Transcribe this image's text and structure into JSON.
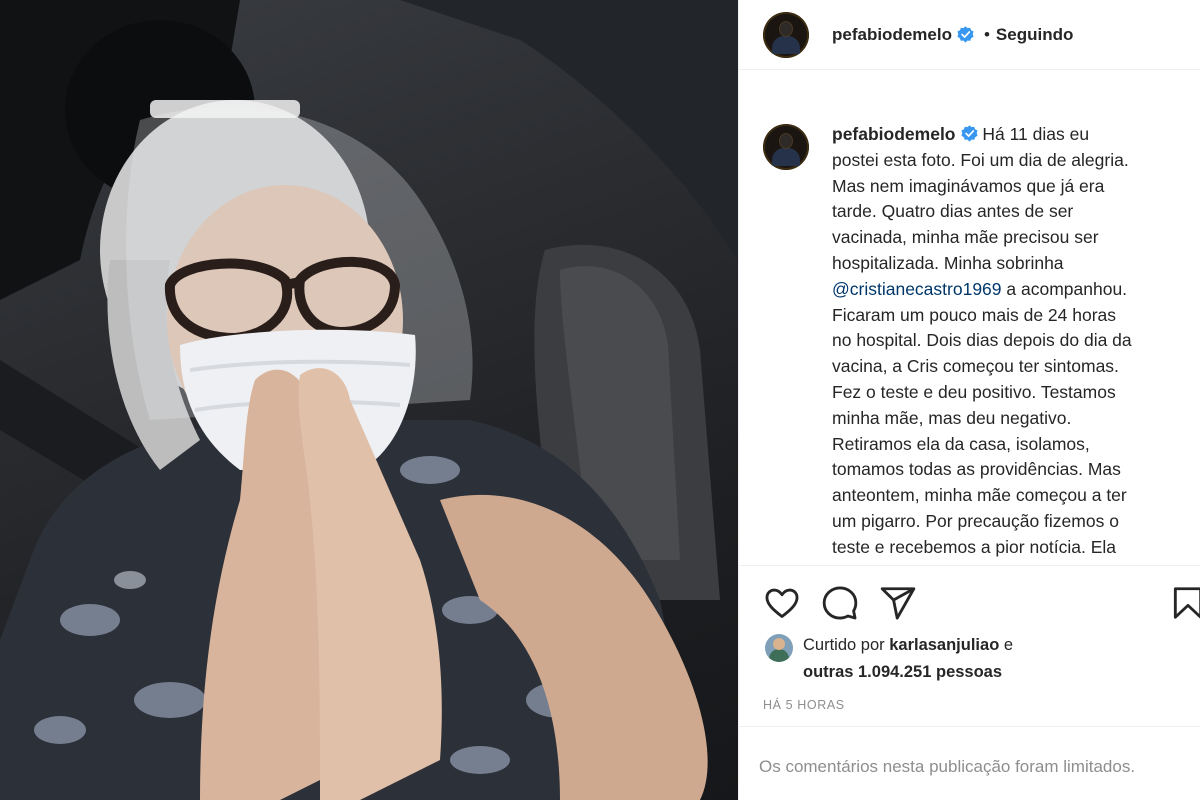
{
  "post": {
    "username": "pefabiodemelo",
    "separator": "•",
    "follow_status": "Seguindo",
    "caption_user": "pefabiodemelo",
    "caption_lines": [
      "Há 11 dias eu",
      "postei esta foto. Foi um dia de alegria.",
      "Mas nem imaginávamos que já era",
      "tarde. Quatro dias antes de ser",
      "vacinada, minha mãe precisou ser",
      "hospitalizada. Minha sobrinha",
      "a acompanhou.",
      "Ficaram um pouco mais de 24 horas",
      "no hospital. Dois dias depois do dia da",
      "vacina, a Cris começou ter sintomas.",
      "Fez o teste e deu positivo. Testamos",
      "minha mãe, mas deu negativo.",
      "Retiramos ela da casa, isolamos,",
      "tomamos todas as providências. Mas",
      "anteontem, minha mãe começou a ter",
      "um pigarro. Por precaução fizemos o",
      "teste e recebemos a pior notícia. Ela"
    ],
    "mention": "@cristianecastro1969",
    "likes_prefix": "Curtido por",
    "liked_by_user": "karlasanjuliao",
    "likes_conjunction": "e",
    "likes_others": "outras 1.094.251 pessoas",
    "timestamp": "HÁ 5 HORAS",
    "comments_limited": "Os comentários nesta publicação foram limitados."
  },
  "icons": {
    "verified": "verified-badge-icon",
    "like": "heart-icon",
    "comment": "comment-bubble-icon",
    "share": "paper-plane-icon",
    "save": "bookmark-icon"
  },
  "colors": {
    "verified": "#3897f0",
    "mention": "#00376b",
    "secondary_text": "#8e8e8e",
    "divider": "#efefef"
  }
}
